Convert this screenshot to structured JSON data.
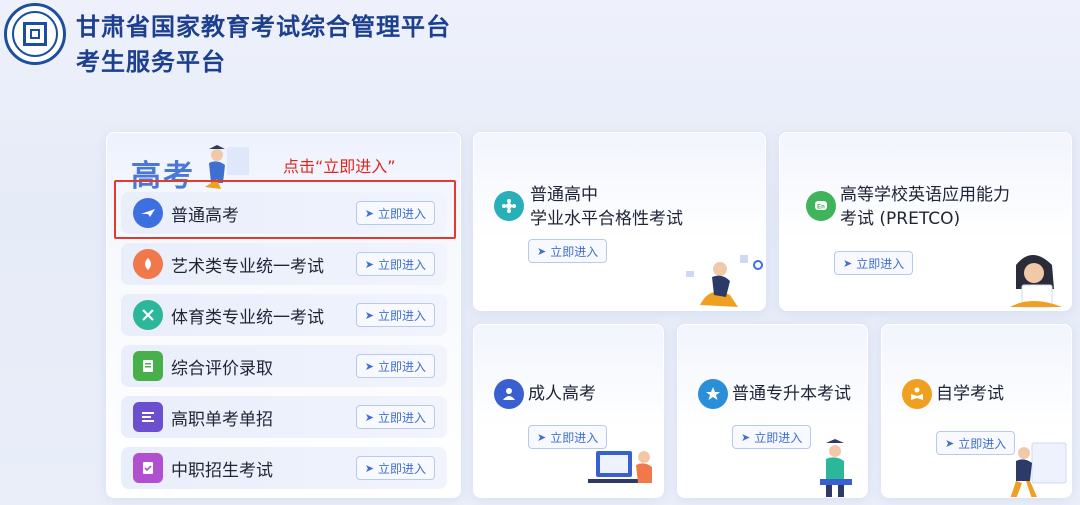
{
  "header": {
    "title_line1": "甘肃省国家教育考试综合管理平台",
    "title_line2": "考生服务平台"
  },
  "gaokao_panel": {
    "title": "高考",
    "hint": "点击“立即进入”",
    "items": [
      {
        "label": "普通高考",
        "button": "立即进入",
        "icon": "plane-icon",
        "color": "#3d6fe0"
      },
      {
        "label": "艺术类专业统一考试",
        "button": "立即进入",
        "icon": "art-icon",
        "color": "#f0784a"
      },
      {
        "label": "体育类专业统一考试",
        "button": "立即进入",
        "icon": "sports-icon",
        "color": "#2cb69a"
      },
      {
        "label": "综合评价录取",
        "button": "立即进入",
        "icon": "doc-icon",
        "color": "#47b04a"
      },
      {
        "label": "高职单考单招",
        "button": "立即进入",
        "icon": "list-icon",
        "color": "#6a4fcf"
      },
      {
        "label": "中职招生考试",
        "button": "立即进入",
        "icon": "form-icon",
        "color": "#b04fcf"
      }
    ]
  },
  "cards": {
    "xueye": {
      "title_line1": "普通高中",
      "title_line2": "学业水平合格性考试",
      "button": "立即进入",
      "color": "#28b0b8"
    },
    "pretco": {
      "title_line1": "高等学校英语应用能力",
      "title_line2": "考试 (PRETCO)",
      "button": "立即进入",
      "color": "#3fb45a"
    },
    "chengren": {
      "title": "成人高考",
      "button": "立即进入",
      "color": "#3a5fd0"
    },
    "zhuanshengben": {
      "title": "普通专升本考试",
      "button": "立即进入",
      "color": "#2a8fd8"
    },
    "zixue": {
      "title": "自学考试",
      "button": "立即进入",
      "color": "#f0a020"
    }
  }
}
